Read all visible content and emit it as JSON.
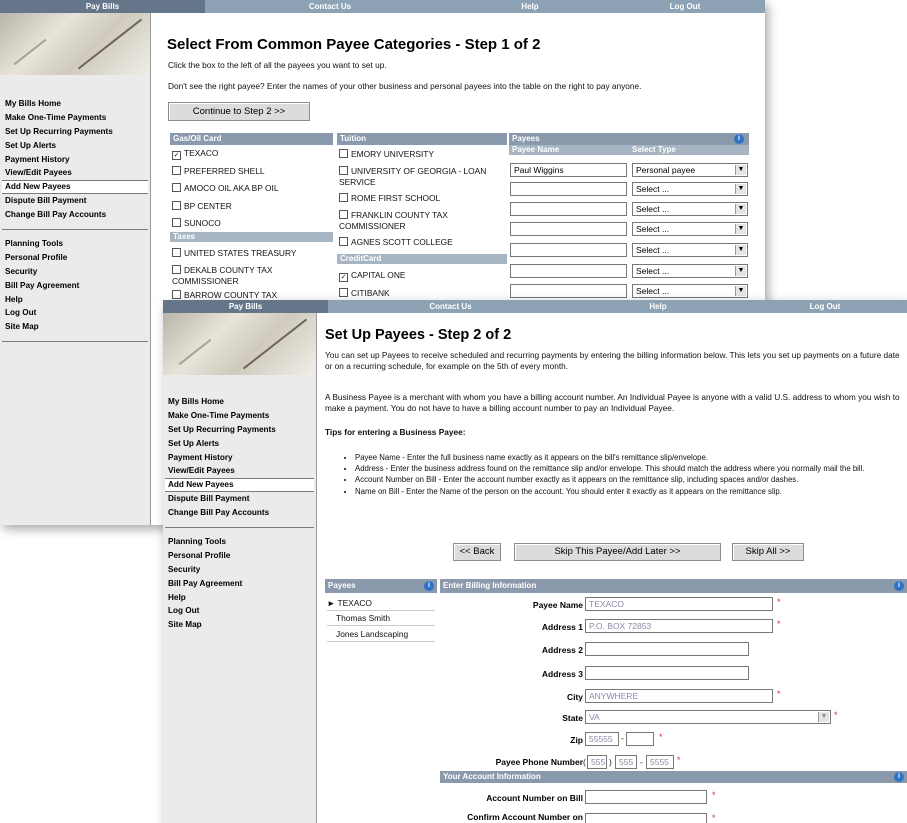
{
  "nav": {
    "pay_bills": "Pay Bills",
    "contact_us": "Contact Us",
    "help": "Help",
    "log_out": "Log Out"
  },
  "sidebar": {
    "group1": [
      "My Bills Home",
      "Make One-Time Payments",
      "Set Up Recurring Payments",
      "Set Up Alerts",
      "Payment History",
      "View/Edit Payees",
      "Add New Payees",
      "Dispute Bill Payment",
      "Change Bill Pay Accounts"
    ],
    "group2": [
      "Planning Tools",
      "Personal Profile",
      "Security",
      "Bill Pay Agreement",
      "Help",
      "Log Out",
      "Site Map"
    ]
  },
  "step1": {
    "title": "Select From Common Payee Categories - Step 1 of 2",
    "instr1": "Click the box to the left of all the payees you want to set up.",
    "instr2": "Don't see the right payee?   Enter the names of your other business and personal payees into the table on the right to pay anyone.",
    "continue_btn": "Continue to Step 2 >>",
    "gas_header": "Gas/Oil Card",
    "gas_items": [
      {
        "label": "TEXACO",
        "checked": true
      },
      {
        "label": "PREFERRED SHELL",
        "checked": false
      },
      {
        "label": "AMOCO OIL AKA BP OIL",
        "checked": false
      },
      {
        "label": "BP CENTER",
        "checked": false
      },
      {
        "label": "SUNOCO",
        "checked": false
      }
    ],
    "taxes_header": "Taxes",
    "taxes_items": [
      {
        "label": "UNITED STATES TREASURY"
      },
      {
        "label": "DEKALB COUNTY TAX COMMISSIONER"
      },
      {
        "label": "BARROW COUNTY TAX"
      }
    ],
    "tuition_header": "Tuition",
    "tuition_items": [
      {
        "label": "EMORY UNIVERSITY"
      },
      {
        "label": "UNIVERSITY OF GEORGIA - LOAN SERVICE"
      },
      {
        "label": "ROME FIRST SCHOOL"
      },
      {
        "label": "FRANKLIN COUNTY TAX COMMISSIONER"
      },
      {
        "label": "AGNES SCOTT COLLEGE"
      }
    ],
    "credit_header": "CreditCard",
    "credit_items": [
      {
        "label": "CAPITAL ONE",
        "checked": true
      },
      {
        "label": "CITIBANK",
        "checked": false
      }
    ],
    "payees_header": "Payees",
    "payee_name_col": "Payee Name",
    "select_type_col": "Select Type",
    "payee_rows": [
      {
        "name": "Paul Wiggins",
        "type": "Personal payee"
      },
      {
        "name": "",
        "type": "Select ..."
      },
      {
        "name": "",
        "type": "Select ..."
      },
      {
        "name": "",
        "type": "Select ..."
      },
      {
        "name": "",
        "type": "Select ..."
      },
      {
        "name": "",
        "type": "Select ..."
      }
    ]
  },
  "step2": {
    "title": "Set Up Payees - Step 2 of 2",
    "para1": "You can set up Payees to receive scheduled and recurring payments by entering the billing information below. This lets you set up payments on a future date or on a recurring schedule, for example on the 5th of every month.",
    "para2": "A Business Payee is a merchant with whom you have a billing account number. An Individual Payee is anyone with a valid U.S. address to whom you wish to make a payment. You do not have to have a billing account number to pay an Individual Payee.",
    "tips_title": "Tips for entering a Business Payee:",
    "tips": [
      "Payee Name - Enter the full business name exactly as it appears on the bill's remittance slip/envelope.",
      "Address - Enter the business address found on the remittance slip and/or envelope. This should match the address where you normally mail the bill.",
      "Account Number on Bill - Enter the account number exactly as it appears on the remittance slip, including spaces and/or dashes.",
      "Name on Bill - Enter the Name of the person on the account. You should enter it exactly as it appears on the remittance slip."
    ],
    "back_btn": "<< Back",
    "skip_btn": "Skip This Payee/Add Later >>",
    "skip_all_btn": "Skip All >>",
    "payees_header": "Payees",
    "payees": [
      "TEXACO",
      "Thomas Smith",
      "Jones Landscaping"
    ],
    "billing_header": "Enter Billing Information",
    "fields": {
      "payee_name": {
        "label": "Payee Name",
        "value": "TEXACO"
      },
      "address1": {
        "label": "Address 1",
        "value": "P.O. BOX 72853"
      },
      "address2": {
        "label": "Address 2",
        "value": ""
      },
      "address3": {
        "label": "Address 3",
        "value": ""
      },
      "city": {
        "label": "City",
        "value": "ANYWHERE"
      },
      "state": {
        "label": "State",
        "value": "VA"
      },
      "zip": {
        "label": "Zip",
        "value": "55555",
        "value2": ""
      },
      "phone": {
        "label": "Payee Phone Number",
        "area": "555",
        "prefix": "555",
        "line": "5555"
      }
    },
    "account_header": "Your Account Information",
    "account_number_label": "Account Number on Bill",
    "confirm_account_label": "Confirm Account Number on"
  },
  "colors": {
    "nav": "#8ea2b6",
    "nav_active": "#65768b",
    "col_header": "#8a9aac",
    "sub_header": "#a7b5c3",
    "required": "#e03030",
    "info": "#2f73c8"
  }
}
